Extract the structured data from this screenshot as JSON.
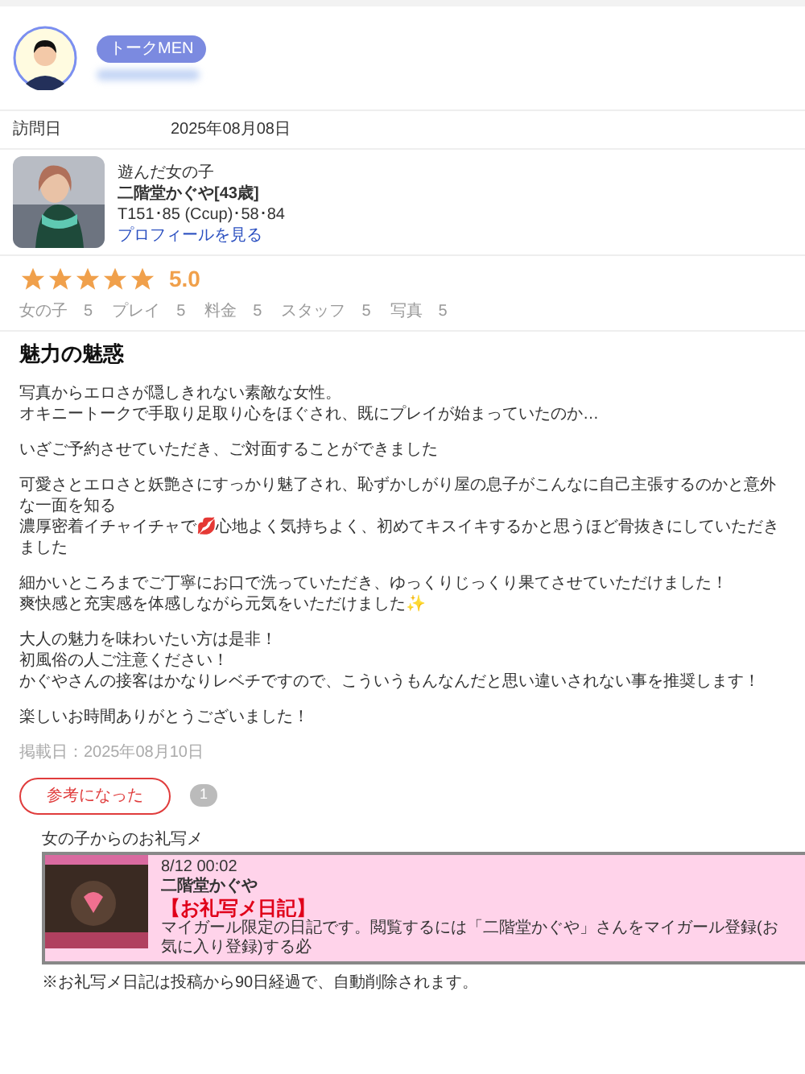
{
  "user": {
    "badge": "トークMEN"
  },
  "visit": {
    "label": "訪問日",
    "value": "2025年08月08日"
  },
  "girl": {
    "caption": "遊んだ女の子",
    "name": "二階堂かぐや[43歳]",
    "measurements": "T151･85 (Ccup)･58･84",
    "profile_link": "プロフィールを見る"
  },
  "rating": {
    "stars": 5,
    "score": "5.0",
    "categories": [
      {
        "label": "女の子",
        "value": "5"
      },
      {
        "label": "プレイ",
        "value": "5"
      },
      {
        "label": "料金",
        "value": "5"
      },
      {
        "label": "スタッフ",
        "value": "5"
      },
      {
        "label": "写真",
        "value": "5"
      }
    ]
  },
  "review": {
    "title": "魅力の魅惑",
    "paragraphs": [
      [
        "写真からエロさが隠しきれない素敵な女性。",
        "オキニートークで手取り足取り心をほぐされ、既にプレイが始まっていたのか…"
      ],
      [
        "いざご予約させていただき、ご対面することができました"
      ],
      [
        "可愛さとエロさと妖艶さにすっかり魅了され、恥ずかしがり屋の息子がこんなに自己主張するのかと意外な一面を知る",
        "濃厚密着イチャイチャで💋心地よく気持ちよく、初めてキスイキするかと思うほど骨抜きにしていただきました"
      ],
      [
        "細かいところまでご丁寧にお口で洗っていただき、ゆっくりじっくり果てさせていただけました！",
        "爽快感と充実感を体感しながら元気をいただけました✨"
      ],
      [
        "大人の魅力を味わいたい方は是非！",
        "初風俗の人ご注意ください！",
        "かぐやさんの接客はかなりレベチですので、こういうもんなんだと思い違いされない事を推奨します！"
      ],
      [
        "楽しいお時間ありがとうございました！"
      ]
    ],
    "posted": "掲載日：2025年08月10日",
    "helpful_button": {
      "label": "参考になった",
      "selected": false
    },
    "helpful_count": "1"
  },
  "thanks_photo": {
    "heading": "女の子からのお礼写メ",
    "time": "8/12 00:02",
    "name": "二階堂かぐや",
    "title": "【お礼写メ日記】",
    "text": "マイガール限定の日記です。閲覧するには「二階堂かぐや」さんをマイガール登録(お気に入り登録)する必",
    "note": "※お礼写メ日記は投稿から90日経過で、自動削除されます。"
  }
}
